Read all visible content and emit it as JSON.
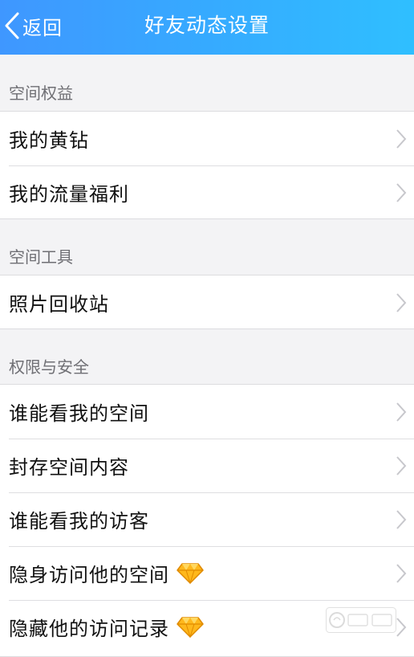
{
  "nav": {
    "back_label": "返回",
    "title": "好友动态设置",
    "gradient_start": "#3f97ff",
    "gradient_end": "#2fbfff"
  },
  "sections": [
    {
      "header": "空间权益",
      "items": [
        {
          "label": "我的黄钻",
          "icon": "chevron-right-icon"
        },
        {
          "label": "我的流量福利",
          "icon": "chevron-right-icon"
        }
      ]
    },
    {
      "header": "空间工具",
      "items": [
        {
          "label": "照片回收站",
          "icon": "chevron-right-icon"
        }
      ]
    },
    {
      "header": "权限与安全",
      "items": [
        {
          "label": "谁能看我的空间",
          "icon": "chevron-right-icon"
        },
        {
          "label": "封存空间内容",
          "icon": "chevron-right-icon"
        },
        {
          "label": "谁能看我的访客",
          "icon": "chevron-right-icon"
        },
        {
          "label": "隐身访问他的空间",
          "icon": "chevron-right-icon",
          "badge": "diamond-icon"
        },
        {
          "label": "隐藏他的访问记录",
          "icon": "chevron-right-icon",
          "badge": "diamond-icon"
        }
      ]
    }
  ],
  "watermark": {
    "icon": "baidu-jingyan-watermark"
  }
}
